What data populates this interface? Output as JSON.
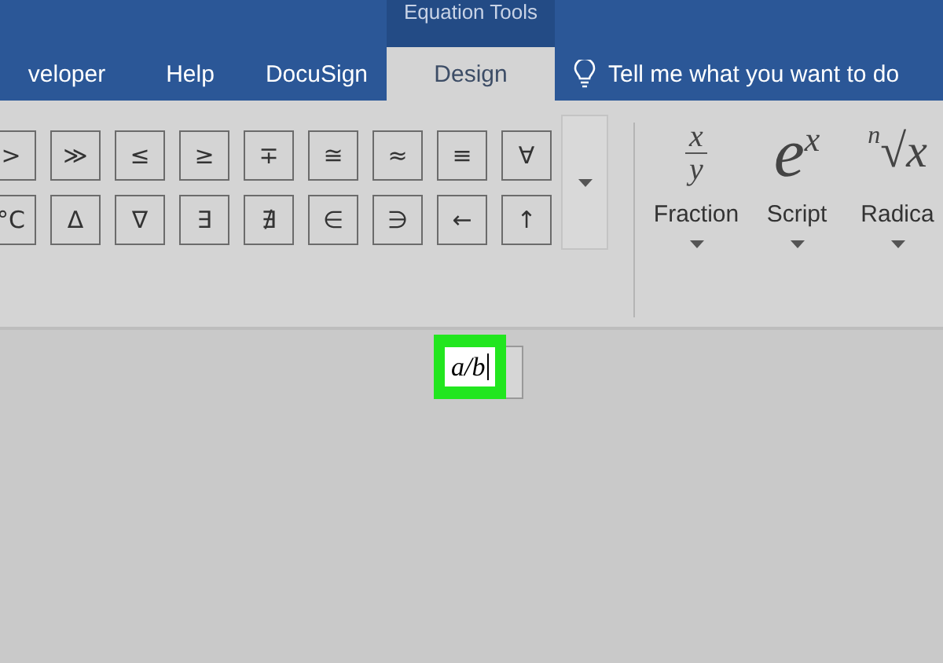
{
  "context_tab": {
    "title": "Equation Tools"
  },
  "tabs": [
    {
      "label": "veloper",
      "selected": false
    },
    {
      "label": "Help",
      "selected": false
    },
    {
      "label": "DocuSign",
      "selected": false
    },
    {
      "label": "Design",
      "selected": true
    }
  ],
  "tell_me": {
    "placeholder": "Tell me what you want to do"
  },
  "symbols": [
    [
      ">",
      "≫",
      "≤",
      "≥",
      "∓",
      "≅",
      "≈",
      "≡",
      "∀"
    ],
    [
      "°C",
      "Δ",
      "∇",
      "∃",
      "∄",
      "∈",
      "∋",
      "←",
      "↑"
    ]
  ],
  "structures": [
    {
      "kind": "fraction",
      "label": "Fraction",
      "glyphs": [
        "x",
        "y"
      ]
    },
    {
      "kind": "script",
      "label": "Script",
      "glyphs": [
        "e",
        "x"
      ]
    },
    {
      "kind": "radical",
      "label": "Radica",
      "glyphs": [
        "n",
        "√x"
      ]
    }
  ],
  "equation": {
    "value": "a/b",
    "highlighted": true
  }
}
